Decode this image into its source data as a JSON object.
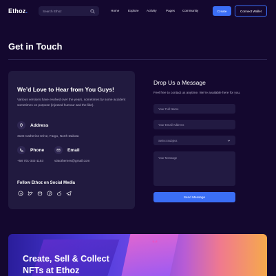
{
  "header": {
    "logo_main": "Ethoz",
    "logo_dot": ".",
    "search_placeholder": "Search Ethoz",
    "nav": [
      "Home",
      "Explore",
      "Activity",
      "Pages",
      "Community"
    ],
    "create_label": "Create",
    "wallet_label": "Connect Wallet"
  },
  "page": {
    "title": "Get in Touch"
  },
  "card": {
    "title": "We’d Love to Hear from You Guys!",
    "description": "Various versions have evolved over the years, sometimes by some accident sometimes on purpose (injected humour and the like).",
    "address_label": "Address",
    "address_value": "3102 Catherine Drive, Fargo, North Dakota",
    "phone_label": "Phone",
    "phone_value": "+58 701-332-1153",
    "email_label": "Email",
    "email_value": "viatothemes@gmail.com",
    "social_title": "Follow Ethoz on Social Media",
    "social_icons": [
      "facebook-icon",
      "twitter-icon",
      "discord-icon",
      "pinterest-icon",
      "reddit-icon",
      "telegram-icon"
    ]
  },
  "form": {
    "title": "Drop Us a Message",
    "description": "Feel free to contact us anytime. We’re available here for you.",
    "name_placeholder": "Your Full Name",
    "email_placeholder": "Your Email Address",
    "subject_placeholder": "Select Subject",
    "message_placeholder": "Your Message",
    "send_label": "Send Message"
  },
  "banner": {
    "line1": "Create, Sell & Collect",
    "line2": "NFTs at Ethoz"
  },
  "colors": {
    "background": "#14082f",
    "card": "#211a3f",
    "accent": "#3b6ef6",
    "muted_text": "#b9b4cc"
  }
}
